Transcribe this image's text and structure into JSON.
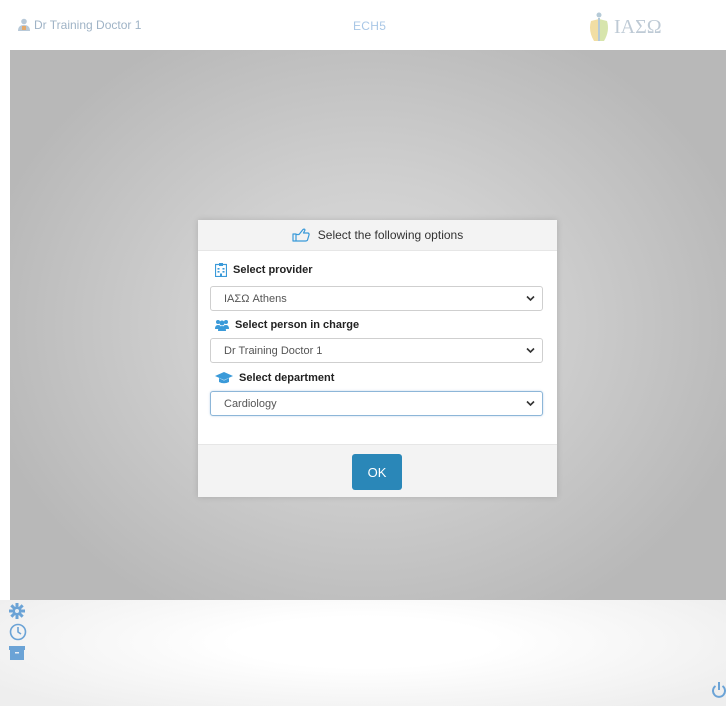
{
  "header": {
    "user_name": "Dr Training Doctor 1",
    "system_code": "ECH5",
    "logo_text": "ΙΑΣΩ"
  },
  "dialog": {
    "title": "Select the following options",
    "provider": {
      "label": "Select provider",
      "value": "ΙΑΣΩ Athens"
    },
    "person": {
      "label": "Select person in charge",
      "value": "Dr Training Doctor 1"
    },
    "department": {
      "label": "Select department",
      "value": "Cardiology"
    },
    "ok_label": "OK"
  },
  "colors": {
    "accent": "#2a87b8",
    "icon_blue": "#3a9ad9",
    "overlay": "#c4c4c4"
  },
  "icons": {
    "user": "user-icon",
    "pointer": "hand-pointer-icon",
    "provider": "hospital-icon",
    "person": "users-icon",
    "department": "graduation-cap-icon",
    "settings": "gear-icon",
    "clock": "clock-icon",
    "archive": "archive-icon",
    "power": "power-icon"
  }
}
